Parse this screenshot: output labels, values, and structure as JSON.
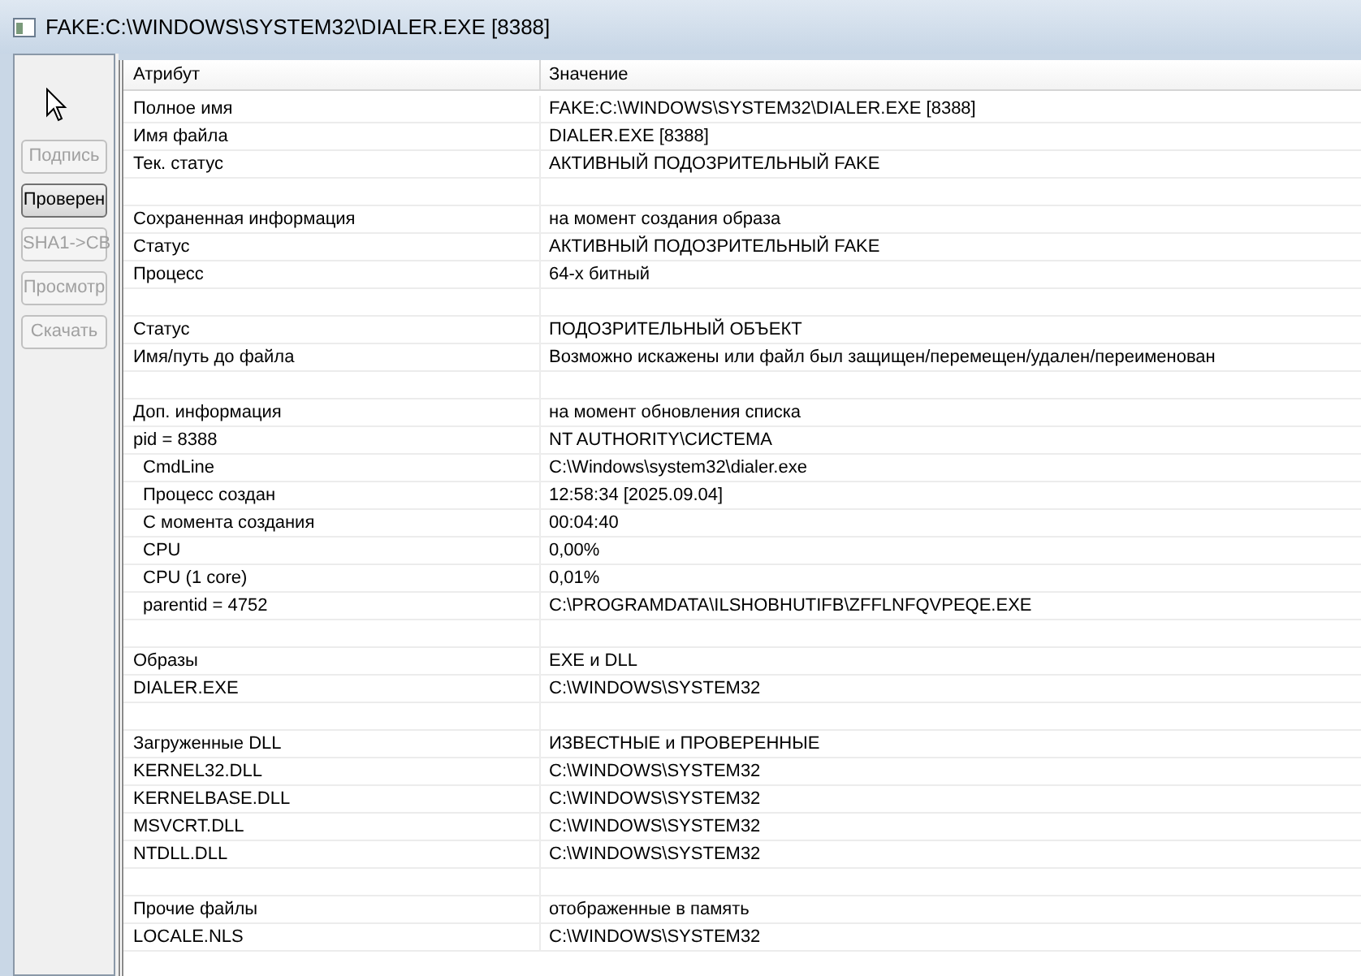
{
  "window": {
    "title": "FAKE:C:\\WINDOWS\\SYSTEM32\\DIALER.EXE [8388]"
  },
  "buttons": [
    {
      "label": "Подпись",
      "disabled": true
    },
    {
      "label": "Проверен",
      "disabled": false
    },
    {
      "label": "SHA1->CB",
      "disabled": true
    },
    {
      "label": "Просмотр",
      "disabled": true
    },
    {
      "label": "Скачать",
      "disabled": true
    }
  ],
  "table": {
    "columns": [
      "Атрибут",
      "Значение"
    ],
    "rows": [
      {
        "kind": "item",
        "attribute": "Полное имя",
        "value": "FAKE:C:\\WINDOWS\\SYSTEM32\\DIALER.EXE [8388]"
      },
      {
        "kind": "item",
        "attribute": "Имя файла",
        "value": "DIALER.EXE [8388]"
      },
      {
        "kind": "item",
        "attribute": "Тек. статус",
        "value": "АКТИВНЫЙ ПОДОЗРИТЕЛЬНЫЙ FAKE"
      },
      {
        "kind": "blank"
      },
      {
        "kind": "item",
        "attribute": "Сохраненная информация",
        "value": "на момент создания образа"
      },
      {
        "kind": "item",
        "attribute": "Статус",
        "value": "АКТИВНЫЙ ПОДОЗРИТЕЛЬНЫЙ FAKE"
      },
      {
        "kind": "item",
        "attribute": "Процесс",
        "value": "64-х битный"
      },
      {
        "kind": "blank"
      },
      {
        "kind": "item",
        "attribute": "Статус",
        "value": "ПОДОЗРИТЕЛЬНЫЙ ОБЪЕКТ"
      },
      {
        "kind": "item",
        "attribute": "Имя/путь до файла",
        "value": "Возможно искажены или файл был защищен/перемещен/удален/переименован"
      },
      {
        "kind": "blank"
      },
      {
        "kind": "item",
        "attribute": "Доп. информация",
        "value": "на момент обновления списка"
      },
      {
        "kind": "item",
        "attribute": "pid = 8388",
        "value": "NT AUTHORITY\\СИСТЕМА",
        "children": [
          {
            "kind": "item",
            "attribute": "CmdLine",
            "value": "C:\\Windows\\system32\\dialer.exe"
          },
          {
            "kind": "item",
            "attribute": "Процесс создан",
            "value": "12:58:34 [2025.09.04]"
          },
          {
            "kind": "item",
            "attribute": "С момента создания",
            "value": "00:04:40"
          },
          {
            "kind": "item",
            "attribute": "CPU",
            "value": "0,00%"
          },
          {
            "kind": "item",
            "attribute": "CPU (1 core)",
            "value": "0,01%"
          },
          {
            "kind": "item",
            "attribute": "parentid = 4752",
            "value": "C:\\PROGRAMDATA\\ILSHOBHUTIFB\\ZFFLNFQVPEQE.EXE"
          }
        ]
      },
      {
        "kind": "blank"
      },
      {
        "kind": "item",
        "attribute": "Образы",
        "value": "EXE и DLL"
      },
      {
        "kind": "item",
        "attribute": "DIALER.EXE",
        "value": "C:\\WINDOWS\\SYSTEM32"
      },
      {
        "kind": "blank"
      },
      {
        "kind": "item",
        "attribute": "Загруженные DLL",
        "value": "ИЗВЕСТНЫЕ и ПРОВЕРЕННЫЕ"
      },
      {
        "kind": "item",
        "attribute": "KERNEL32.DLL",
        "value": "C:\\WINDOWS\\SYSTEM32"
      },
      {
        "kind": "item",
        "attribute": "KERNELBASE.DLL",
        "value": "C:\\WINDOWS\\SYSTEM32"
      },
      {
        "kind": "item",
        "attribute": "MSVCRT.DLL",
        "value": "C:\\WINDOWS\\SYSTEM32"
      },
      {
        "kind": "item",
        "attribute": "NTDLL.DLL",
        "value": "C:\\WINDOWS\\SYSTEM32"
      },
      {
        "kind": "blank"
      },
      {
        "kind": "item",
        "attribute": "Прочие файлы",
        "value": "отображенные в память"
      },
      {
        "kind": "item",
        "attribute": "LOCALE.NLS",
        "value": "C:\\WINDOWS\\SYSTEM32"
      }
    ]
  }
}
